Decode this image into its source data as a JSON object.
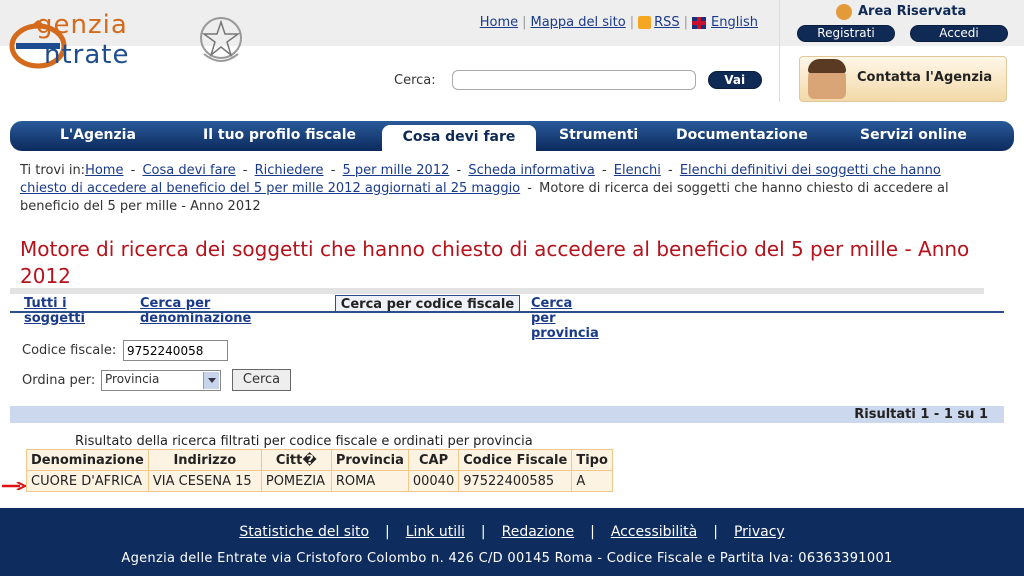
{
  "header": {
    "logo_line1": "genzia",
    "logo_line2": "ntrate",
    "top_links": {
      "home": "Home",
      "sitemap": "Mappa del sito",
      "rss": "RSS",
      "english": "English"
    },
    "search_label": "Cerca:",
    "search_value": "",
    "search_button": "Vai",
    "area_riservata": "Area Riservata",
    "registrati": "Registrati",
    "accedi": "Accedi",
    "contatta": "Contatta l'Agenzia"
  },
  "nav": {
    "items": [
      "L'Agenzia",
      "Il tuo profilo fiscale",
      "Cosa devi fare",
      "Strumenti",
      "Documentazione",
      "Servizi online"
    ],
    "active": "Cosa devi fare"
  },
  "breadcrumb": {
    "prefix": "Ti trovi in:",
    "links": [
      "Home",
      "Cosa devi fare",
      "Richiedere",
      "5 per mille 2012",
      "Scheda informativa",
      "Elenchi",
      "Elenchi definitivi dei soggetti che hanno chiesto di accedere al beneficio del 5 per mille 2012 aggiornati al 25 maggio"
    ],
    "current": "Motore di ricerca dei soggetti che hanno chiesto di accedere al beneficio del 5 per mille - Anno 2012"
  },
  "page_title": "Motore di ricerca dei soggetti che hanno chiesto di accedere al beneficio del 5 per mille - Anno 2012",
  "tabs": [
    "Tutti i soggetti",
    "Cerca per denominazione",
    "Cerca per codice fiscale",
    "Cerca per provincia"
  ],
  "form": {
    "codice_label": "Codice fiscale:",
    "codice_value": "9752240058",
    "ordina_label": "Ordina per:",
    "ordina_value": "Provincia",
    "submit": "Cerca"
  },
  "results": {
    "summary": "Risultati 1 - 1 su 1",
    "caption": "Risultato della ricerca filtrati per codice fiscale e ordinati per provincia",
    "headers": [
      "Denominazione",
      "Indirizzo",
      "Citt�",
      "Provincia",
      "CAP",
      "Codice Fiscale",
      "Tipo"
    ],
    "rows": [
      [
        "CUORE D'AFRICA",
        "VIA CESENA 15",
        "POMEZIA",
        "ROMA",
        "00040",
        "97522400585",
        "A"
      ]
    ]
  },
  "footer": {
    "links": [
      "Statistiche del sito",
      "Link utili",
      "Redazione",
      "Accessibilità",
      "Privacy"
    ],
    "text": "Agenzia delle Entrate via Cristoforo Colombo n. 426 C/D 00145 Roma - Codice Fiscale e Partita Iva: 06363391001"
  },
  "colors": {
    "navy": "#0e2c5e",
    "title_red": "#b5121b",
    "logo_orange": "#d46b1c",
    "table_border": "#f0c88a"
  }
}
